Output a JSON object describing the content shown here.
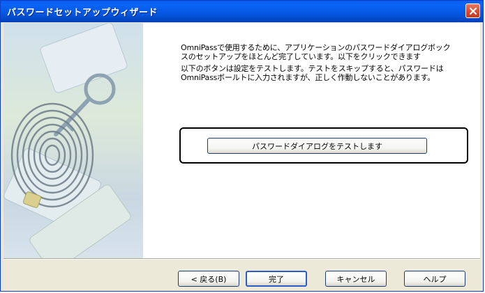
{
  "window": {
    "title": "パスワードセットアップウィザード"
  },
  "description": {
    "line1": "OmniPassで使用するために、アプリケーションのパスワードダイアログボック",
    "line2": "スのセットアップをほとんど完了しています。以下をクリックできます",
    "line3": "以下のボタンは設定をテストします。テストをスキップすると、パスワードは",
    "line4": "OmniPassボールトに入力されますが、正しく作動しないことがあります。"
  },
  "test_button_label": "パスワードダイアログをテストします",
  "footer": {
    "back_label": "< 戻る(B)",
    "finish_label": "完了",
    "cancel_label": "キャンセル",
    "help_label": "ヘルプ"
  },
  "icons": {
    "close": "close-icon",
    "sidebar": "fingerprint-illustration"
  },
  "colors": {
    "titlebar": "#0457e2",
    "close_button": "#d9472b",
    "dialog_background": "#ece9d8",
    "content_background": "#ffffff"
  }
}
